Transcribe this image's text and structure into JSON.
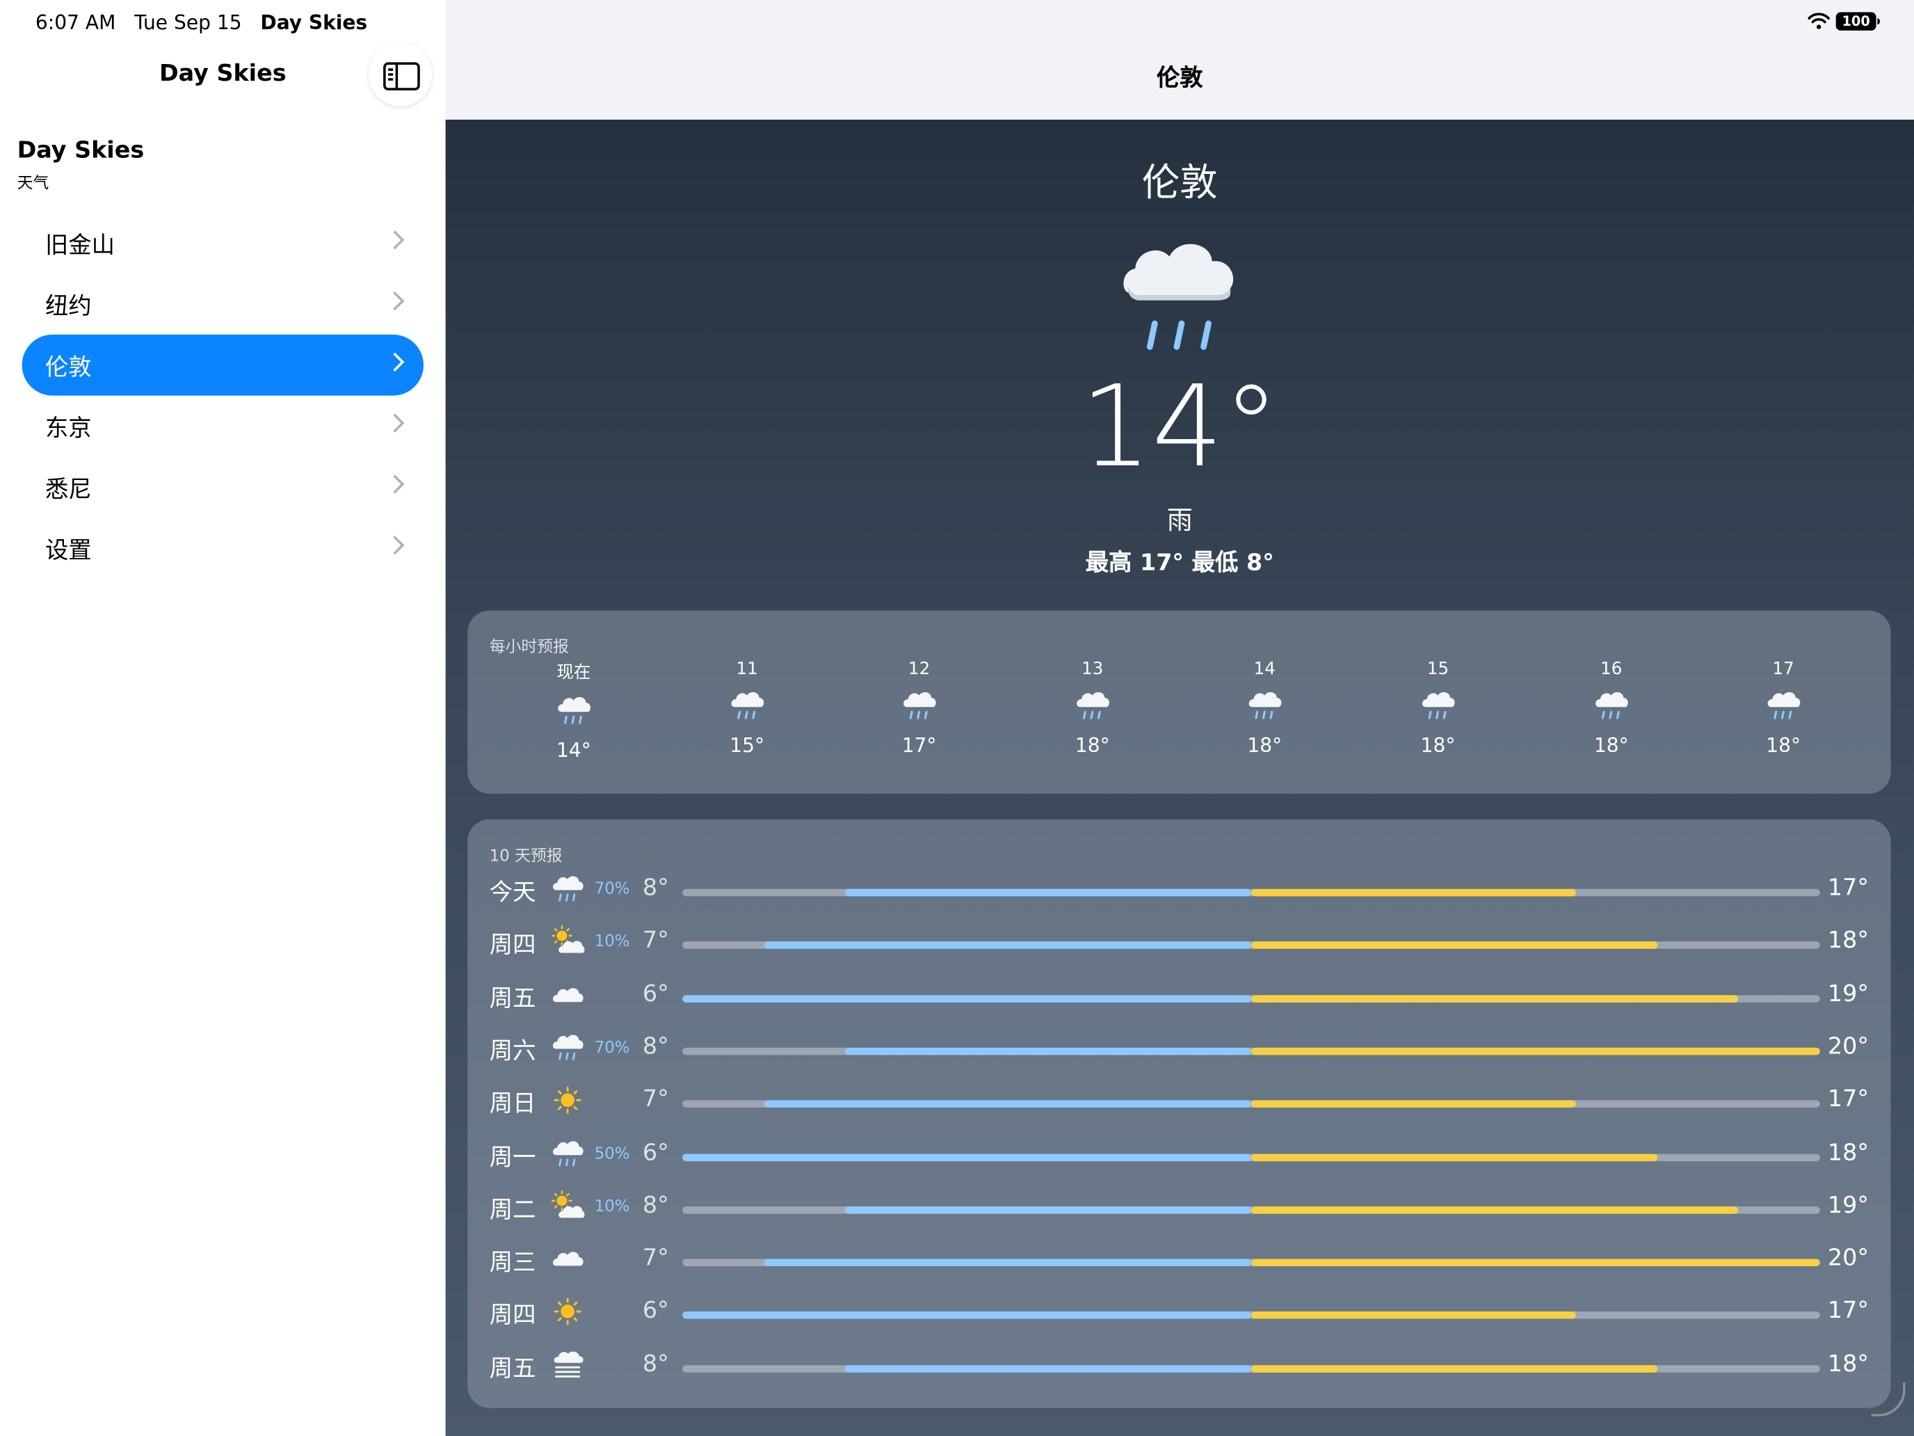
{
  "status_bar": {
    "time": "6:07 AM",
    "date": "Tue Sep 15",
    "app": "Day Skies",
    "battery": "100"
  },
  "sidebar": {
    "nav_title": "Day Skies",
    "app_title": "Day Skies",
    "app_subtitle": "天气",
    "items": [
      {
        "label": "旧金山",
        "active": false
      },
      {
        "label": "纽约",
        "active": false
      },
      {
        "label": "伦敦",
        "active": true
      },
      {
        "label": "东京",
        "active": false
      },
      {
        "label": "悉尼",
        "active": false
      },
      {
        "label": "设置",
        "active": false
      }
    ]
  },
  "header": {
    "title": "伦敦"
  },
  "current": {
    "city": "伦敦",
    "temp": "14°",
    "condition": "雨",
    "hilo": "最高 17° 最低 8°",
    "icon": "rain-icon"
  },
  "hourly": {
    "title": "每小时预报",
    "hours": [
      {
        "time": "现在",
        "temp": "14°",
        "icon": "rain-icon"
      },
      {
        "time": "11",
        "temp": "15°",
        "icon": "rain-icon"
      },
      {
        "time": "12",
        "temp": "17°",
        "icon": "rain-icon"
      },
      {
        "time": "13",
        "temp": "18°",
        "icon": "rain-icon"
      },
      {
        "time": "14",
        "temp": "18°",
        "icon": "rain-icon"
      },
      {
        "time": "15",
        "temp": "18°",
        "icon": "rain-icon"
      },
      {
        "time": "16",
        "temp": "18°",
        "icon": "rain-icon"
      },
      {
        "time": "17",
        "temp": "18°",
        "icon": "rain-icon"
      }
    ]
  },
  "daily": {
    "title": "10 天预报",
    "scale_min": 6,
    "scale_max": 20,
    "days": [
      {
        "day": "今天",
        "icon": "rain",
        "precip": "70%",
        "low": "8°",
        "high": "17°",
        "low_val": 8,
        "high_val": 17
      },
      {
        "day": "周四",
        "icon": "partly-sunny",
        "precip": "10%",
        "low": "7°",
        "high": "18°",
        "low_val": 7,
        "high_val": 18
      },
      {
        "day": "周五",
        "icon": "cloud",
        "precip": "",
        "low": "6°",
        "high": "19°",
        "low_val": 6,
        "high_val": 19
      },
      {
        "day": "周六",
        "icon": "rain",
        "precip": "70%",
        "low": "8°",
        "high": "20°",
        "low_val": 8,
        "high_val": 20
      },
      {
        "day": "周日",
        "icon": "sun",
        "precip": "",
        "low": "7°",
        "high": "17°",
        "low_val": 7,
        "high_val": 17
      },
      {
        "day": "周一",
        "icon": "rain",
        "precip": "50%",
        "low": "6°",
        "high": "18°",
        "low_val": 6,
        "high_val": 18
      },
      {
        "day": "周二",
        "icon": "partly-sunny",
        "precip": "10%",
        "low": "8°",
        "high": "19°",
        "low_val": 8,
        "high_val": 19
      },
      {
        "day": "周三",
        "icon": "cloud",
        "precip": "",
        "low": "7°",
        "high": "20°",
        "low_val": 7,
        "high_val": 20
      },
      {
        "day": "周四",
        "icon": "sun",
        "precip": "",
        "low": "6°",
        "high": "17°",
        "low_val": 6,
        "high_val": 17
      },
      {
        "day": "周五",
        "icon": "fog",
        "precip": "",
        "low": "8°",
        "high": "18°",
        "low_val": 8,
        "high_val": 18
      }
    ]
  },
  "colors": {
    "accent": "#0a84ff",
    "cool": "#8ec8ff",
    "warm": "#f7d046",
    "sun": "#ffc21a"
  }
}
